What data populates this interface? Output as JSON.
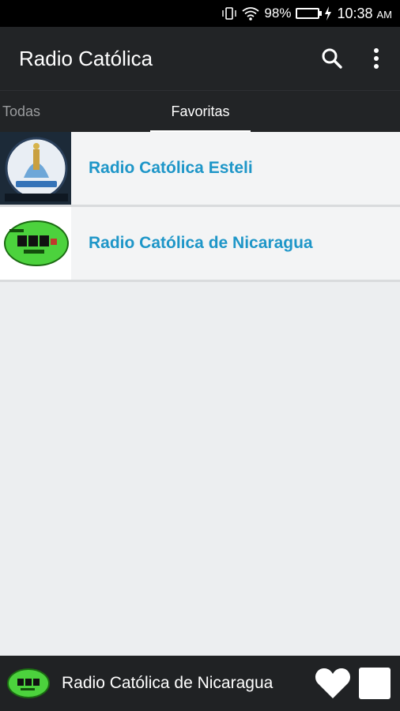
{
  "status_bar": {
    "battery": "98%",
    "time": "10:38",
    "ampm": "AM",
    "icons": [
      "vibrate-icon",
      "wifi-icon",
      "battery-icon",
      "charging-icon"
    ]
  },
  "app_bar": {
    "title": "Radio Católica",
    "icons": [
      "search-icon",
      "more-vert-icon"
    ]
  },
  "tabs": [
    {
      "label": "Todas",
      "selected": false
    },
    {
      "label": "Favoritas",
      "selected": true
    }
  ],
  "stations": [
    {
      "name": "Radio Católica Esteli",
      "logo": "station-logo-esteli"
    },
    {
      "name": "Radio Católica de Nicaragua",
      "logo": "station-logo-nicaragua"
    }
  ],
  "player": {
    "now_playing": "Radio Católica de Nicaragua",
    "icons": [
      "heart-icon",
      "stop-icon"
    ]
  },
  "colors": {
    "app_bar": "#222426",
    "accent_text": "#1e96c8",
    "background": "#eceef0",
    "battery_fill": "#3ddc5a"
  }
}
